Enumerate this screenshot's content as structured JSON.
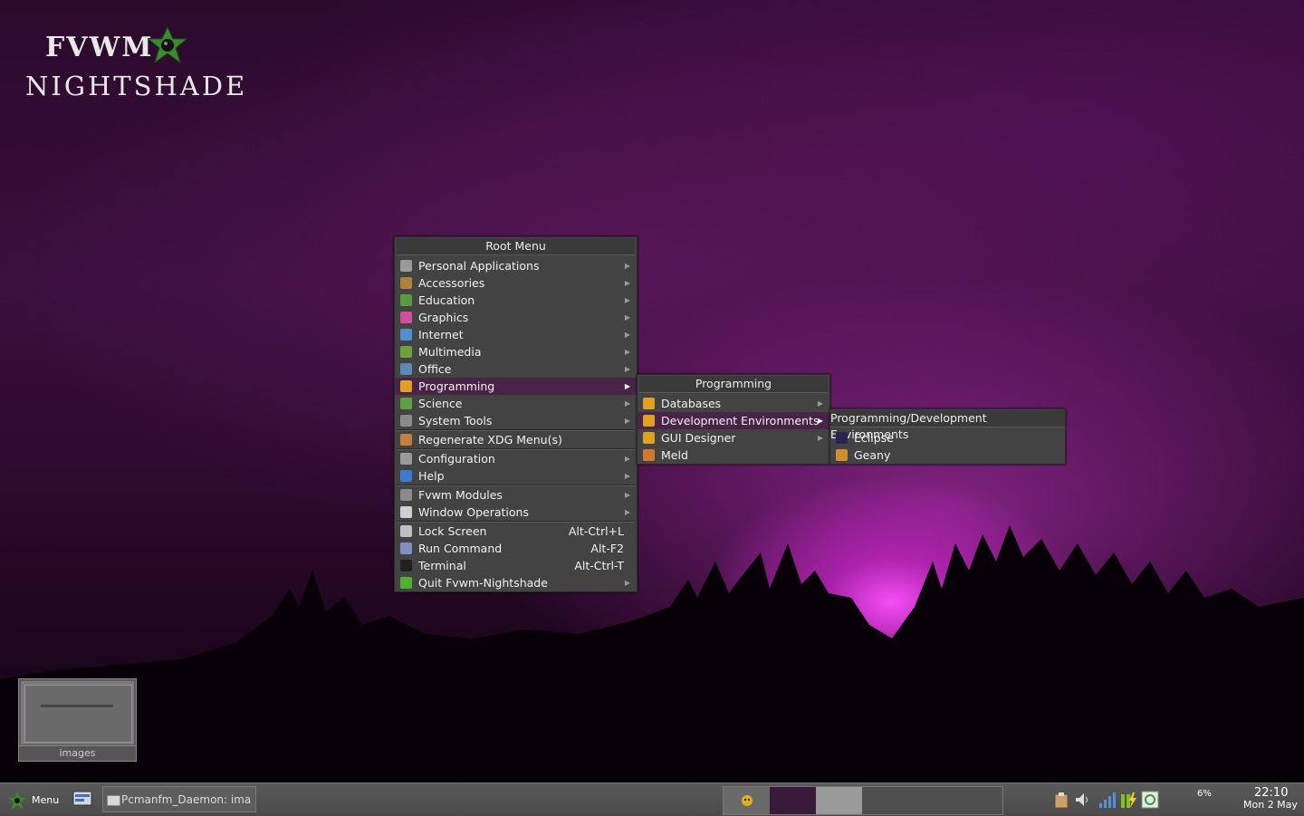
{
  "logo": {
    "line1": "FVWM",
    "line2": "NIGHTSHADE"
  },
  "root_menu": {
    "title": "Root Menu",
    "groups": [
      [
        {
          "label": "Personal Applications",
          "icon": "home-icon",
          "color": "#9a9a9a",
          "submenu": true
        },
        {
          "label": "Accessories",
          "icon": "accessories-icon",
          "color": "#b08040",
          "submenu": true
        },
        {
          "label": "Education",
          "icon": "education-icon",
          "color": "#5a9a40",
          "submenu": true
        },
        {
          "label": "Graphics",
          "icon": "graphics-icon",
          "color": "#d04fa0",
          "submenu": true
        },
        {
          "label": "Internet",
          "icon": "internet-icon",
          "color": "#4f8fd0",
          "submenu": true
        },
        {
          "label": "Multimedia",
          "icon": "multimedia-icon",
          "color": "#70a040",
          "submenu": true
        },
        {
          "label": "Office",
          "icon": "office-icon",
          "color": "#5a8ab0",
          "submenu": true
        },
        {
          "label": "Programming",
          "icon": "programming-icon",
          "color": "#e0a020",
          "submenu": true,
          "active": true
        },
        {
          "label": "Science",
          "icon": "science-icon",
          "color": "#60a040",
          "submenu": true
        },
        {
          "label": "System Tools",
          "icon": "system-tools-icon",
          "color": "#8a8a8a",
          "submenu": true
        }
      ],
      [
        {
          "label": "Regenerate XDG Menu(s)",
          "icon": "regenerate-icon",
          "color": "#c08040",
          "submenu": false
        }
      ],
      [
        {
          "label": "Configuration",
          "icon": "configuration-icon",
          "color": "#9a9a9a",
          "submenu": true
        },
        {
          "label": "Help",
          "icon": "help-icon",
          "color": "#3a7ad0",
          "submenu": true
        }
      ],
      [
        {
          "label": "Fvwm Modules",
          "icon": "modules-icon",
          "color": "#8a8a8a",
          "submenu": true
        },
        {
          "label": "Window Operations",
          "icon": "window-ops-icon",
          "color": "#d0d0d0",
          "submenu": true
        }
      ],
      [
        {
          "label": "Lock Screen",
          "icon": "lock-icon",
          "color": "#c0c0c0",
          "shortcut": "Alt-Ctrl+L"
        },
        {
          "label": "Run Command",
          "icon": "run-icon",
          "color": "#8090c0",
          "shortcut": "Alt-F2"
        },
        {
          "label": "Terminal",
          "icon": "terminal-icon",
          "color": "#202020",
          "shortcut": "Alt-Ctrl-T"
        },
        {
          "label": "Quit Fvwm-Nightshade",
          "icon": "quit-icon",
          "color": "#50b030",
          "submenu": true
        }
      ]
    ]
  },
  "programming_menu": {
    "title": "Programming",
    "items": [
      {
        "label": "Databases",
        "icon": "databases-icon",
        "color": "#e0a020",
        "submenu": true
      },
      {
        "label": "Development Environments",
        "icon": "dev-env-icon",
        "color": "#e0a020",
        "submenu": true,
        "active": true
      },
      {
        "label": "GUI Designer",
        "icon": "gui-designer-icon",
        "color": "#e0a020",
        "submenu": true
      },
      {
        "label": "Meld",
        "icon": "meld-icon",
        "color": "#d07a30",
        "submenu": false
      }
    ]
  },
  "devenv_menu": {
    "title": "Programming/Development Environments",
    "items": [
      {
        "label": "Eclipse",
        "icon": "eclipse-icon",
        "color": "#2c2255"
      },
      {
        "label": "Geany",
        "icon": "geany-icon",
        "color": "#d09030"
      }
    ]
  },
  "desktop_pager": {
    "label": "images"
  },
  "taskbar": {
    "menu_label": "Menu",
    "task_label": "Pcmanfm_Daemon: ima",
    "cpu": "6%",
    "time": "22:10",
    "date": "Mon  2 May"
  }
}
